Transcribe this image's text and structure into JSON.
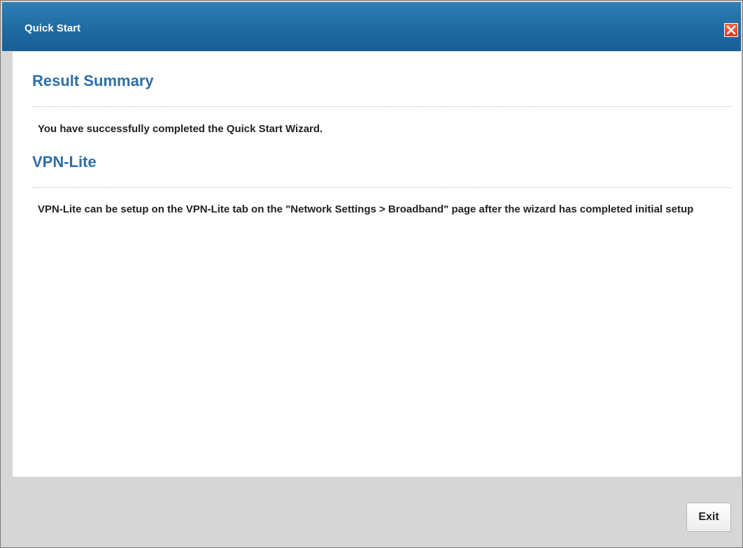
{
  "window": {
    "title": "Quick Start",
    "close_icon": "close-icon"
  },
  "sections": {
    "result_summary": {
      "heading": "Result Summary",
      "text": "You have successfully completed the Quick Start Wizard."
    },
    "vpn_lite": {
      "heading": "VPN-Lite",
      "text": "VPN-Lite can be setup on the VPN-Lite tab on the \"Network Settings > Broadband\" page after the wizard has completed initial setup"
    }
  },
  "footer": {
    "exit_label": "Exit"
  },
  "colors": {
    "title_bar": "#1f6aa2",
    "heading": "#2e6fa7",
    "close_button": "#e04a2a"
  }
}
